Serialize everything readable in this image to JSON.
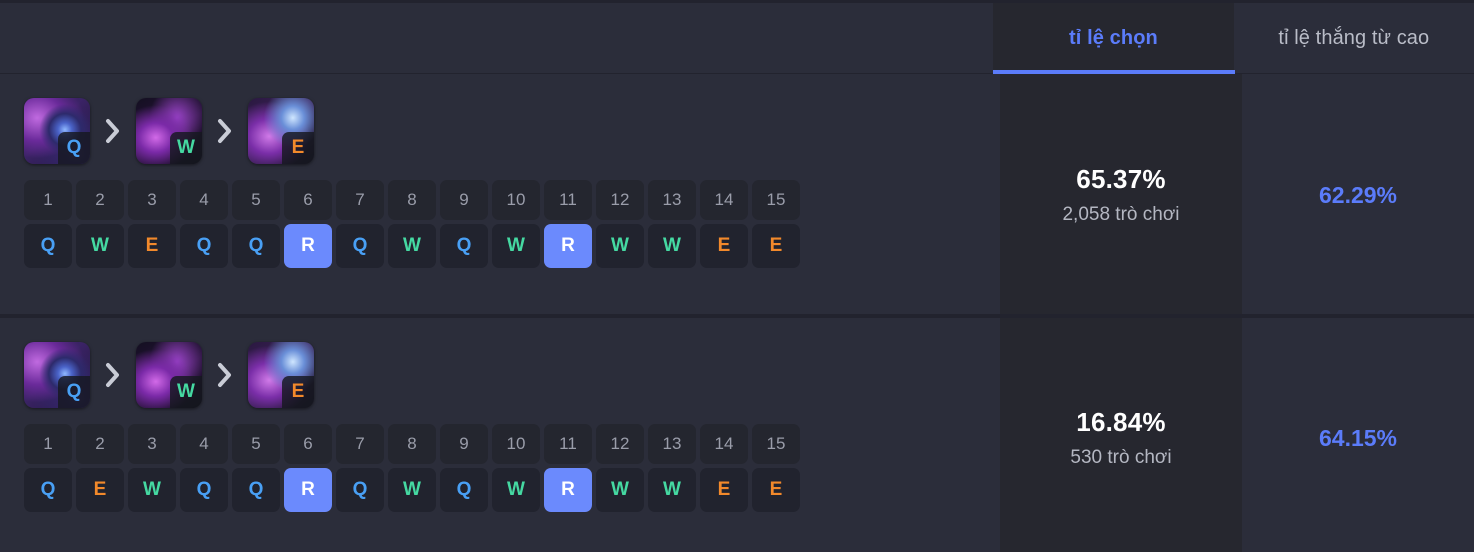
{
  "tabs": [
    {
      "label": "tỉ lệ chọn",
      "active": true
    },
    {
      "label": "tỉ lệ thắng từ cao",
      "active": false
    }
  ],
  "colors": {
    "accent_blue": "#5b7cfa",
    "key_q": "#49a0f5",
    "key_w": "#45d9a2",
    "key_e": "#f2892b",
    "key_r_bg": "#6b8afd",
    "panel_bg": "#2b2d3a",
    "highlight_col_bg": "#26272f"
  },
  "levels": [
    "1",
    "2",
    "3",
    "4",
    "5",
    "6",
    "7",
    "8",
    "9",
    "10",
    "11",
    "12",
    "13",
    "14",
    "15"
  ],
  "rows": [
    {
      "skill_order": [
        "Q",
        "W",
        "E"
      ],
      "sequence": [
        "Q",
        "W",
        "E",
        "Q",
        "Q",
        "R",
        "Q",
        "W",
        "Q",
        "W",
        "R",
        "W",
        "W",
        "E",
        "E"
      ],
      "pick_rate": "65.37%",
      "games": "2,058 trò chơi",
      "win_rate": "62.29%"
    },
    {
      "skill_order": [
        "Q",
        "W",
        "E"
      ],
      "sequence": [
        "Q",
        "E",
        "W",
        "Q",
        "Q",
        "R",
        "Q",
        "W",
        "Q",
        "W",
        "R",
        "W",
        "W",
        "E",
        "E"
      ],
      "pick_rate": "16.84%",
      "games": "530 trò chơi",
      "win_rate": "64.15%"
    }
  ]
}
